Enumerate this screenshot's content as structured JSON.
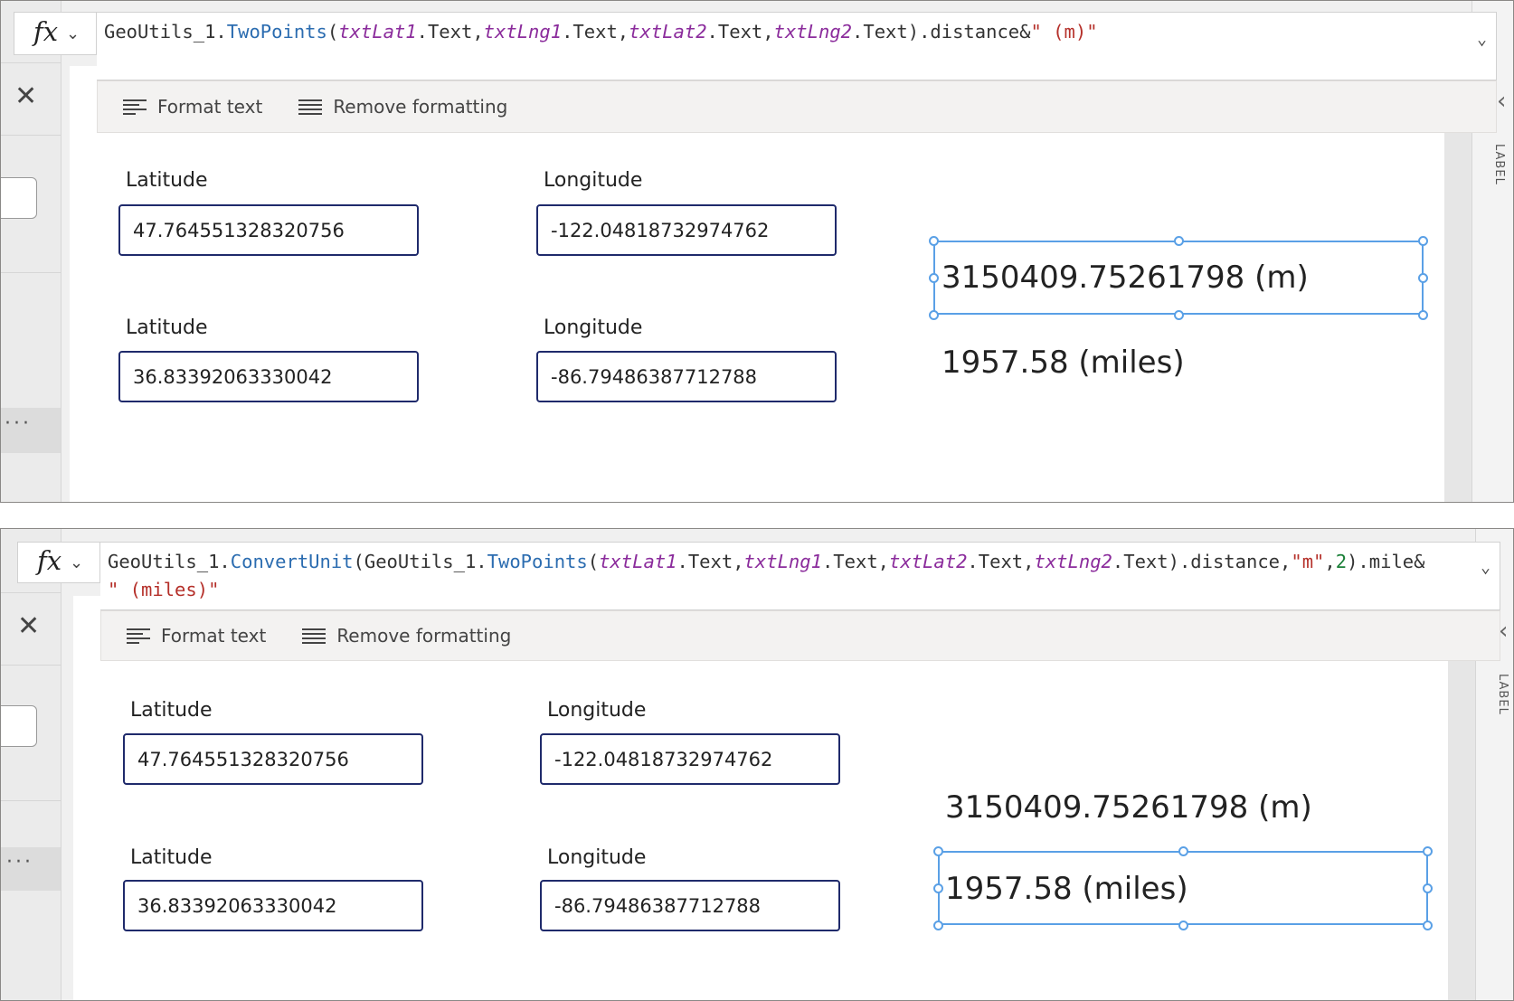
{
  "panels": [
    {
      "fx_label": "fx",
      "formula_line1": [
        {
          "t": "GeoUtils_1.",
          "c": ""
        },
        {
          "t": "TwoPoints",
          "c": "fn"
        },
        {
          "t": "(",
          "c": ""
        },
        {
          "t": "txtLat1",
          "c": "var"
        },
        {
          "t": ".Text,",
          "c": ""
        },
        {
          "t": "txtLng1",
          "c": "var"
        },
        {
          "t": ".Text,",
          "c": ""
        },
        {
          "t": "txtLat2",
          "c": "var"
        },
        {
          "t": ".Text,",
          "c": ""
        },
        {
          "t": "txtLng2",
          "c": "var"
        },
        {
          "t": ".Text).distance&",
          "c": ""
        },
        {
          "t": "\" (m)\"",
          "c": "str"
        }
      ],
      "formula_line2": [],
      "format_text": "Format text",
      "remove_formatting": "Remove formatting",
      "side_label": "LABEL",
      "lat_label_1": "Latitude",
      "lng_label_1": "Longitude",
      "lat_label_2": "Latitude",
      "lng_label_2": "Longitude",
      "lat1": "47.764551328320756",
      "lng1": "-122.04818732974762",
      "lat2": "36.83392063330042",
      "lng2": "-86.79486387712788",
      "result_m": "3150409.75261798 (m)",
      "result_miles": "1957.58 (miles)",
      "selected": "m"
    },
    {
      "fx_label": "fx",
      "formula_line1": [
        {
          "t": "GeoUtils_1.",
          "c": ""
        },
        {
          "t": "ConvertUnit",
          "c": "fn"
        },
        {
          "t": "(GeoUtils_1.",
          "c": ""
        },
        {
          "t": "TwoPoints",
          "c": "fn"
        },
        {
          "t": "(",
          "c": ""
        },
        {
          "t": "txtLat1",
          "c": "var"
        },
        {
          "t": ".Text,",
          "c": ""
        },
        {
          "t": "txtLng1",
          "c": "var"
        },
        {
          "t": ".Text,",
          "c": ""
        },
        {
          "t": "txtLat2",
          "c": "var"
        },
        {
          "t": ".Text,",
          "c": ""
        },
        {
          "t": "txtLng2",
          "c": "var"
        },
        {
          "t": ".Text).distance,",
          "c": ""
        },
        {
          "t": "\"m\"",
          "c": "str"
        },
        {
          "t": ",",
          "c": ""
        },
        {
          "t": "2",
          "c": "num"
        },
        {
          "t": ").mile&",
          "c": ""
        }
      ],
      "formula_line2": [
        {
          "t": "\" (miles)\"",
          "c": "str"
        }
      ],
      "format_text": "Format text",
      "remove_formatting": "Remove formatting",
      "side_label": "LABEL",
      "lat_label_1": "Latitude",
      "lng_label_1": "Longitude",
      "lat_label_2": "Latitude",
      "lng_label_2": "Longitude",
      "lat1": "47.764551328320756",
      "lng1": "-122.04818732974762",
      "lat2": "36.83392063330042",
      "lng2": "-86.79486387712788",
      "result_m": "3150409.75261798 (m)",
      "result_miles": "1957.58 (miles)",
      "selected": "miles"
    }
  ],
  "icons": {
    "fx_dropdown": "chevron-down-icon",
    "formula_expand": "chevron-down-icon",
    "close": "close-icon",
    "more": "more-icon",
    "format_text": "format-text-icon",
    "remove_formatting": "remove-formatting-icon",
    "collapse_panel": "chevron-left-icon"
  },
  "colors": {
    "input_border": "#1f2a6b",
    "selection": "#5aa0e6",
    "function_name": "#2b6cb0",
    "variable": "#8b2c9c",
    "string": "#b5302a"
  }
}
